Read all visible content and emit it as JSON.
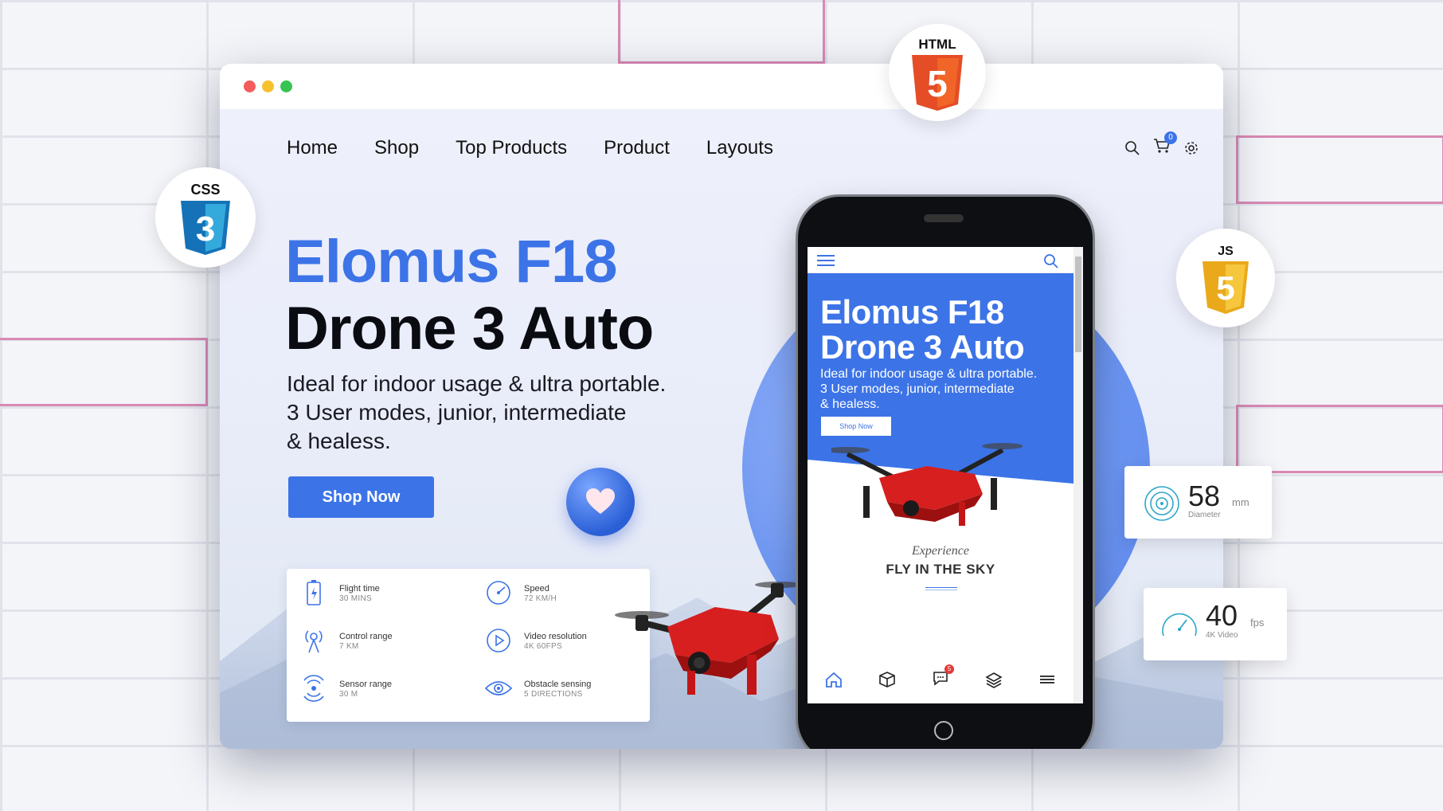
{
  "nav": {
    "items": [
      "Home",
      "Shop",
      "Top Products",
      "Product",
      "Layouts"
    ],
    "cart_count": "0"
  },
  "hero": {
    "title_line1": "Elomus F18",
    "title_line2": "Drone 3 Auto",
    "desc_line1": "Ideal for indoor usage & ultra portable.",
    "desc_line2": "3 User modes, junior, intermediate",
    "desc_line3": "& healess.",
    "cta": "Shop Now"
  },
  "specs": [
    {
      "label": "Flight time",
      "value": "30 MINS",
      "icon": "battery-icon"
    },
    {
      "label": "Speed",
      "value": "72 KM/H",
      "icon": "speedometer-icon"
    },
    {
      "label": "Control range",
      "value": "7 KM",
      "icon": "antenna-icon"
    },
    {
      "label": "Video resolution",
      "value": "4K 60FPS",
      "icon": "play-icon"
    },
    {
      "label": "Sensor range",
      "value": "30 M",
      "icon": "sensor-icon"
    },
    {
      "label": "Obstacle sensing",
      "value": "5 DIRECTIONS",
      "icon": "eye-icon"
    }
  ],
  "mobile": {
    "title_line1": "Elomus F18",
    "title_line2": "Drone 3 Auto",
    "desc_line1": "Ideal for indoor usage & ultra portable.",
    "desc_line2": "3 User modes, junior, intermediate",
    "desc_line3": "& healess.",
    "cta": "Shop Now",
    "experience": "Experience",
    "tagline": "FLY IN THE SKY",
    "chat_badge": "5"
  },
  "badges": {
    "html": "HTML",
    "html_num": "5",
    "css": "CSS",
    "css_num": "3",
    "js": "JS",
    "js_num": "5"
  },
  "stats": [
    {
      "number": "58",
      "unit": "mm",
      "label": "Diameter"
    },
    {
      "number": "40",
      "unit": "fps",
      "label": "4K Video"
    }
  ],
  "colors": {
    "accent": "#3c74e8",
    "html5": "#e44d26",
    "css3": "#2965f1",
    "js": "#f0b81c",
    "drone_red": "#d71f1f"
  }
}
